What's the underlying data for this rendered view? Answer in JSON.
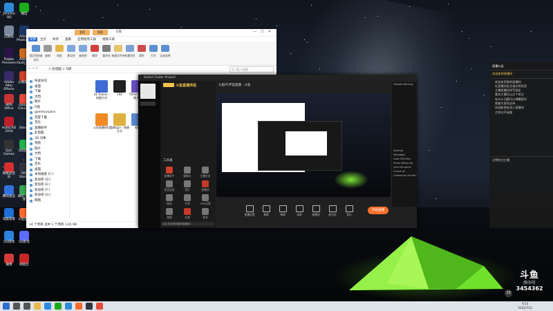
{
  "desktop": {
    "icons": [
      {
        "label": "Tencent QQ",
        "color": "#2e8bd8"
      },
      {
        "label": "微信",
        "color": "#1aad19"
      },
      {
        "label": "回收站",
        "color": "#7b8aa0"
      },
      {
        "label": "Adobe Photoshop",
        "color": "#1b3a66"
      },
      {
        "label": "Adobe Premiere",
        "color": "#2b1547"
      },
      {
        "label": "Adobe Illustrator",
        "color": "#cc6a1d"
      },
      {
        "label": "Adobe After Effects",
        "color": "#3a2a6a"
      },
      {
        "label": "火绒安全",
        "color": "#d0402a"
      },
      {
        "label": "WPS Office",
        "color": "#c73232"
      },
      {
        "label": "Google Chrome",
        "color": "#e44b3a"
      },
      {
        "label": "AutoCAD 2016",
        "color": "#c0202a"
      },
      {
        "label": "Steam",
        "color": "#1b2838"
      },
      {
        "label": "Epic Games",
        "color": "#333333"
      },
      {
        "label": "QQ音乐",
        "color": "#23b04b"
      },
      {
        "label": "网易云音乐",
        "color": "#d4302e"
      },
      {
        "label": "OBS Studio",
        "color": "#303540"
      },
      {
        "label": "腾讯会议",
        "color": "#2f72e0"
      },
      {
        "label": "微信小程序",
        "color": "#34a853"
      },
      {
        "label": "电脑管家",
        "color": "#1f6fd6"
      },
      {
        "label": "斗鱼直播",
        "color": "#ff6a2d"
      },
      {
        "label": "QQ游戏",
        "color": "#2d82df"
      },
      {
        "label": "QQ影音",
        "color": "#5b6cff"
      },
      {
        "label": "微博",
        "color": "#d5393a"
      },
      {
        "label": "网易云",
        "color": "#c62828"
      }
    ]
  },
  "explorer": {
    "ribbon_tabs": [
      "管理",
      "管理"
    ],
    "title": "D盘",
    "menu": [
      "文件",
      "主页",
      "共享",
      "查看",
      "应用程序工具",
      "视频工具"
    ],
    "ribbon": [
      {
        "label": "固定到快速访问",
        "color": "#5b8fd2"
      },
      {
        "label": "复制",
        "color": "#999999"
      },
      {
        "label": "粘贴",
        "color": "#e2b64c"
      },
      {
        "label": "移动到",
        "color": "#7da7da"
      },
      {
        "label": "复制到",
        "color": "#7da7da"
      },
      {
        "label": "删除",
        "color": "#d43d3d"
      },
      {
        "label": "重命名",
        "color": "#7a7a7a"
      },
      {
        "label": "新建文件夹",
        "color": "#e8c46a"
      },
      {
        "label": "新建项目",
        "color": "#7aa2d6"
      },
      {
        "label": "属性",
        "color": "#cf4b4b"
      },
      {
        "label": "打开",
        "color": "#5b8fd2"
      },
      {
        "label": "全部选择",
        "color": "#5b8fd2"
      }
    ],
    "address": "> 此电脑 > D盘",
    "search": "在 D盘 中搜索",
    "nav": [
      "快速访问",
      "桌面",
      "下载",
      "文档",
      "图片",
      "D盘",
      "gamesurpass",
      "百度下载",
      "音乐",
      "直播助手",
      "此电脑",
      "3D 对象",
      "视频",
      "图片",
      "文档",
      "下载",
      "音乐",
      "桌面",
      "本地磁盘 (C:)",
      "新加卷 (D:)",
      "新加卷 (E:)",
      "新加卷 (F:)",
      "新加卷 (G:)",
      "网络"
    ],
    "files": [
      {
        "label": "24 Trainer - 快捷方式",
        "color": "#3e6bd6"
      },
      {
        "label": "104",
        "color": "#222222"
      },
      {
        "label": "TDdemo - 快捷方式",
        "color": "#6b4fc8"
      },
      {
        "label": "斗鱼直播伴侣",
        "color": "#f08a24"
      },
      {
        "label": "酷狗(gz) - 快捷方式",
        "color": "#e0b040"
      },
      {
        "label": "电脑",
        "color": "#5a8ad0"
      }
    ],
    "status": "14 个项目   选中 1 个项目  1.81 KB"
  },
  "douyu": {
    "topbar": "Select Folder  Project",
    "app_name": "斗鱼直播伴侣",
    "panel": [
      {
        "label": "直播助手",
        "color": "#d0402a"
      },
      {
        "label": "摄像头",
        "color": "#777777"
      },
      {
        "label": "主播任务",
        "color": "#777777"
      },
      {
        "label": "语音连麦",
        "color": "#777777"
      },
      {
        "label": "音乐",
        "color": "#777777"
      },
      {
        "label": "直播间",
        "color": "#c43a2a"
      },
      {
        "label": "粉丝",
        "color": "#777777"
      },
      {
        "label": "分享",
        "color": "#777777"
      },
      {
        "label": "OBS设置",
        "color": "#777777"
      },
      {
        "label": "美颜",
        "color": "#777777"
      },
      {
        "label": "礼物",
        "color": "#c43a2a"
      },
      {
        "label": "更多",
        "color": "#777777"
      }
    ],
    "panel_head": "工具箱",
    "stream_title": "斗鱼PC伴侣直播 - 斗鱼",
    "right_items": [
      "Disable Warning",
      "Settings",
      "Messages",
      "Load OSR Skin",
      "Show debug log",
      "Lock the panel",
      "Unlock all",
      "Created by Hunter G"
    ],
    "toolbar": [
      "直播设置",
      "美颜",
      "弹幕",
      "录屏",
      "直播间",
      "麦克风",
      "音乐"
    ],
    "start_btn": "开始直播",
    "bottom_note": "公告:欢迎来到我的直播间..."
  },
  "chat": {
    "title": "直播公告",
    "lines": [
      "欢迎来到我的直播间",
      "在直播间发言请文明用语",
      "主播直播时间不固定",
      "喜欢主播可以点个关注",
      "有什么问题可以弹幕提问",
      "感谢大家的支持",
      "欢迎新朋友进入直播间",
      "点关注不迷路"
    ],
    "highlight": "欢迎来到直播间",
    "tail": "点赞关注主播"
  },
  "watermark": {
    "logo": "斗鱼",
    "sub": "房间号",
    "room_id": "3454362",
    "vip": "15"
  },
  "taskbar": {
    "time": "9:14",
    "date": "2022/7/12",
    "apps": [
      {
        "label": "开始",
        "color": "#2d6fd1"
      },
      {
        "label": "搜索",
        "color": "#555555"
      },
      {
        "label": "任务视图",
        "color": "#555555"
      },
      {
        "label": "文件资源管理器",
        "color": "#e8b84b"
      },
      {
        "label": "Edge",
        "color": "#2a8ae0"
      },
      {
        "label": "微信",
        "color": "#1aad19"
      },
      {
        "label": "QQ",
        "color": "#2e8bd8"
      },
      {
        "label": "斗鱼直播",
        "color": "#ff6a2d"
      },
      {
        "label": "OBS",
        "color": "#303540"
      },
      {
        "label": "Chrome",
        "color": "#e44b3a"
      }
    ]
  }
}
